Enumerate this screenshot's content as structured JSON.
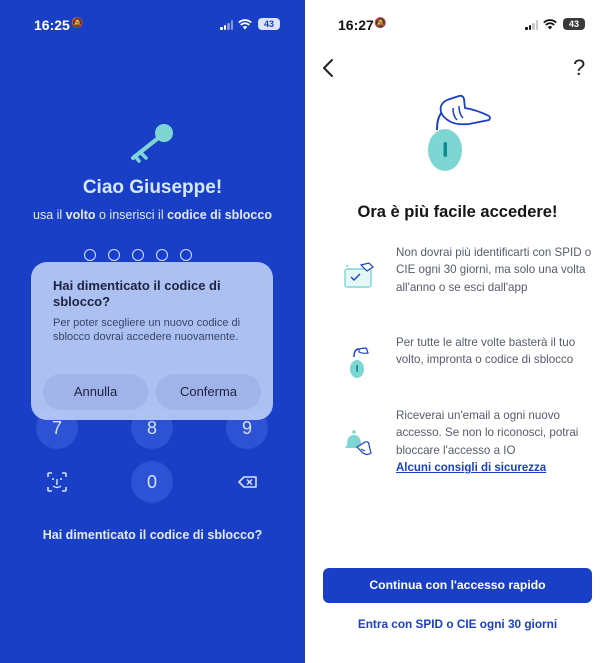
{
  "left": {
    "status": {
      "time": "16:25",
      "battery": "43"
    },
    "greeting": "Ciao Giuseppe!",
    "hint": {
      "prefix": "usa il ",
      "bold1": "volto",
      "mid": " o inserisci il ",
      "bold2": "codice di sblocco"
    },
    "keypad": {
      "k7": "7",
      "k8": "8",
      "k9": "9",
      "k0": "0"
    },
    "forgot_link": "Hai dimenticato il codice di sblocco?",
    "dialog": {
      "title": "Hai dimenticato il codice di sblocco?",
      "message": "Per poter scegliere un nuovo codice di sblocco dovrai accedere nuovamente.",
      "cancel": "Annulla",
      "confirm": "Conferma"
    }
  },
  "right": {
    "status": {
      "time": "16:27",
      "battery": "43"
    },
    "title": "Ora è più facile accedere!",
    "features": [
      {
        "icon": "calendar-check-icon",
        "text": "Non dovrai più identificarti con SPID o CIE ogni 30 giorni, ma solo una volta all'anno o se esci dall'app"
      },
      {
        "icon": "padlock-icon",
        "text": "Per tutte le altre volte basterà il tuo volto, impronta o codice di sblocco"
      },
      {
        "icon": "bell-icon",
        "text": "Riceverai un'email a ogni nuovo accesso. Se non lo riconosci, potrai bloccare l'accesso a IO",
        "link": "Alcuni consigli di sicurezza"
      }
    ],
    "primary_button": "Continua con l'accesso rapido",
    "secondary_link": "Entra con SPID o CIE ogni 30 giorni"
  },
  "colors": {
    "accent": "#1a3fc7",
    "highlight": "#7ed6d4"
  }
}
